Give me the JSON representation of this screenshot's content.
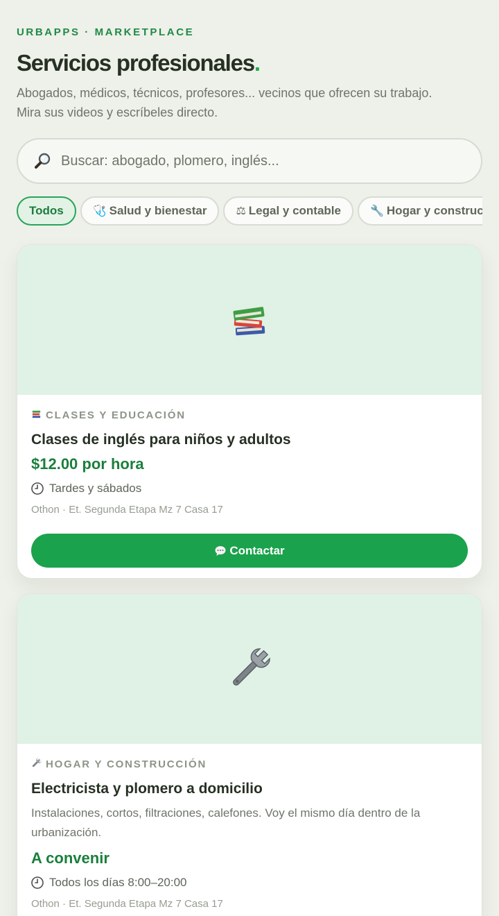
{
  "header": {
    "eyebrow": "URBAPPS · MARKETPLACE",
    "title": "Servicios profesionales",
    "title_dot": ".",
    "subtitle_line1": "Abogados, médicos, técnicos, profesores... vecinos que ofrecen su trabajo.",
    "subtitle_line2": "Mira sus videos y escríbeles directo."
  },
  "search": {
    "icon": "magnifier-icon",
    "placeholder": "Buscar: abogado, plomero, inglés..."
  },
  "filters": [
    {
      "label": "Todos",
      "icon": "",
      "active": true
    },
    {
      "label": "Salud y bienestar",
      "icon": "stethoscope-icon",
      "active": false
    },
    {
      "label": "Legal y contable",
      "icon": "scales-icon",
      "active": false
    },
    {
      "label": "Hogar y construcción",
      "icon": "wrench-icon",
      "active": false
    }
  ],
  "listings": [
    {
      "image_icon": "books-icon",
      "category_icon": "books-icon",
      "category": "CLASES Y EDUCACIÓN",
      "title": "Clases de inglés para niños y adultos",
      "price": "$12.00 por hora",
      "schedule_icon": "clock-icon",
      "schedule": "Tardes y sábados",
      "location": "Othon · Et. Segunda Etapa Mz 7 Casa 17",
      "button_icon": "speech-bubble-icon",
      "button_label": "Contactar"
    },
    {
      "image_icon": "wrench-icon",
      "category_icon": "wrench-icon",
      "category": "HOGAR Y CONSTRUCCIÓN",
      "title": "Electricista y plomero a domicilio",
      "description": "Instalaciones, cortos, filtraciones, calefones. Voy el mismo día dentro de la urbanización.",
      "price": "A convenir",
      "schedule_icon": "clock-icon",
      "schedule": "Todos los días 8:00–20:00",
      "location": "Othon · Et. Segunda Etapa Mz 7 Casa 17"
    }
  ],
  "colors": {
    "background": "#eef0ea",
    "accent": "#1ba24c",
    "accent_dark": "#1a7f3c",
    "hero_bg": "#e0f1e5"
  }
}
